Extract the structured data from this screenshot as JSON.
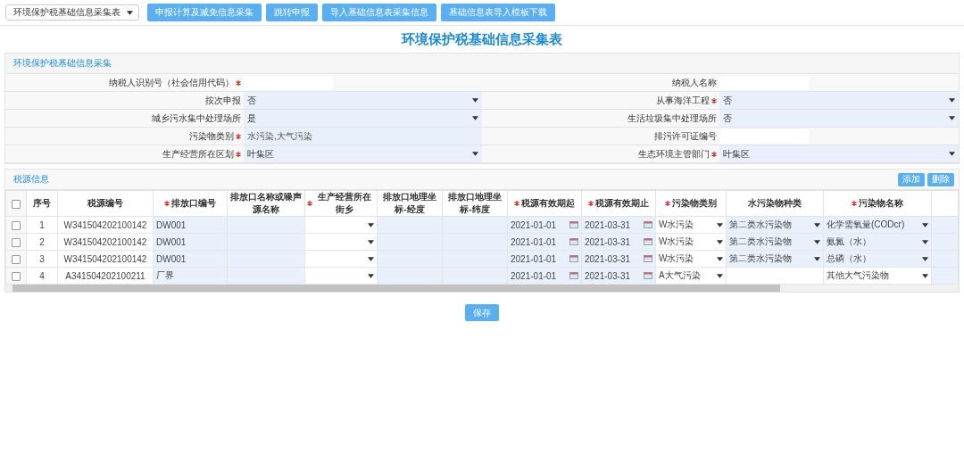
{
  "toolbar": {
    "dropdown": "环境保护税基础信息采集表",
    "buttons": [
      "申报计算及减免信息采集",
      "跳转申报",
      "导入基础信息表采集信息",
      "基础信息表导入模板下载"
    ]
  },
  "title": "环境保护税基础信息采集表",
  "panel_title": "环境保护税基础信息采集",
  "form_rows": [
    [
      {
        "label": "纳税人识别号（社会信用代码）",
        "required": true,
        "kind": "blank"
      },
      {
        "label": "纳税人名称",
        "required": false,
        "kind": "blank"
      }
    ],
    [
      {
        "label": "按次申报",
        "required": false,
        "kind": "select",
        "value": "否"
      },
      {
        "label": "从事海洋工程",
        "required": true,
        "kind": "select",
        "value": "否"
      }
    ],
    [
      {
        "label": "城乡污水集中处理场所",
        "required": false,
        "kind": "select",
        "value": "是"
      },
      {
        "label": "生活垃圾集中处理场所",
        "required": false,
        "kind": "select",
        "value": "否"
      }
    ],
    [
      {
        "label": "污染物类别",
        "required": true,
        "kind": "text",
        "value": "水污染,大气污染"
      },
      {
        "label": "排污许可证编号",
        "required": false,
        "kind": "blank"
      }
    ],
    [
      {
        "label": "生产经营所在区划",
        "required": true,
        "kind": "select",
        "value": "叶集区"
      },
      {
        "label": "生态环境主管部门",
        "required": true,
        "kind": "select",
        "value": "叶集区"
      }
    ]
  ],
  "section_title": "税源信息",
  "section_buttons": [
    "添加",
    "删除"
  ],
  "table": {
    "all_checked": false,
    "columns": [
      {
        "label": "序号",
        "required": false
      },
      {
        "label": "税源编号",
        "required": false
      },
      {
        "label": "排放口编号",
        "required": true
      },
      {
        "label": "排放口名称或噪声源名称",
        "required": false
      },
      {
        "label": "生产经营所在街乡",
        "required": true
      },
      {
        "label": "排放口地理坐标-经度",
        "required": false
      },
      {
        "label": "排放口地理坐标-纬度",
        "required": false
      },
      {
        "label": "税源有效期起",
        "required": true
      },
      {
        "label": "税源有效期止",
        "required": true
      },
      {
        "label": "污染物类别",
        "required": true
      },
      {
        "label": "水污染物种类",
        "required": false
      },
      {
        "label": "污染物名称",
        "required": true
      }
    ],
    "rows": [
      {
        "checked": false,
        "cells": [
          {
            "kind": "text",
            "value": "1"
          },
          {
            "kind": "text",
            "value": "W341504202100142"
          },
          {
            "kind": "input",
            "value": "DW001"
          },
          {
            "kind": "input"
          },
          {
            "kind": "blankselect"
          },
          {
            "kind": "input"
          },
          {
            "kind": "input"
          },
          {
            "kind": "date",
            "value": "2021-01-01"
          },
          {
            "kind": "date",
            "value": "2021-03-31"
          },
          {
            "kind": "choice",
            "value": "W水污染"
          },
          {
            "kind": "select",
            "value": "第二类水污染物"
          },
          {
            "kind": "select",
            "value": "化学需氧量(CODcr)"
          }
        ]
      },
      {
        "checked": false,
        "cells": [
          {
            "kind": "text",
            "value": "2"
          },
          {
            "kind": "text",
            "value": "W341504202100142"
          },
          {
            "kind": "input",
            "value": "DW001"
          },
          {
            "kind": "input"
          },
          {
            "kind": "blankselect"
          },
          {
            "kind": "input"
          },
          {
            "kind": "input"
          },
          {
            "kind": "date",
            "value": "2021-01-01"
          },
          {
            "kind": "date",
            "value": "2021-03-31"
          },
          {
            "kind": "choice",
            "value": "W水污染"
          },
          {
            "kind": "select",
            "value": "第二类水污染物"
          },
          {
            "kind": "select",
            "value": "氨氮（水）"
          }
        ]
      },
      {
        "checked": false,
        "cells": [
          {
            "kind": "text",
            "value": "3"
          },
          {
            "kind": "text",
            "value": "W341504202100142"
          },
          {
            "kind": "input",
            "value": "DW001"
          },
          {
            "kind": "input"
          },
          {
            "kind": "blankselect"
          },
          {
            "kind": "input"
          },
          {
            "kind": "input"
          },
          {
            "kind": "date",
            "value": "2021-01-01"
          },
          {
            "kind": "date",
            "value": "2021-03-31"
          },
          {
            "kind": "choice",
            "value": "W水污染"
          },
          {
            "kind": "select",
            "value": "第二类水污染物"
          },
          {
            "kind": "select",
            "value": "总磷（水）"
          }
        ]
      },
      {
        "checked": false,
        "cells": [
          {
            "kind": "text",
            "value": "4"
          },
          {
            "kind": "text",
            "value": "A341504202100211"
          },
          {
            "kind": "input",
            "value": "厂界"
          },
          {
            "kind": "input"
          },
          {
            "kind": "blankselect"
          },
          {
            "kind": "input"
          },
          {
            "kind": "input"
          },
          {
            "kind": "date",
            "value": "2021-01-01"
          },
          {
            "kind": "date",
            "value": "2021-03-31"
          },
          {
            "kind": "choice",
            "value": "A大气污染"
          },
          {
            "kind": "blank"
          },
          {
            "kind": "choice",
            "value": "其他大气污染物"
          }
        ]
      }
    ]
  },
  "save_button": "保存"
}
